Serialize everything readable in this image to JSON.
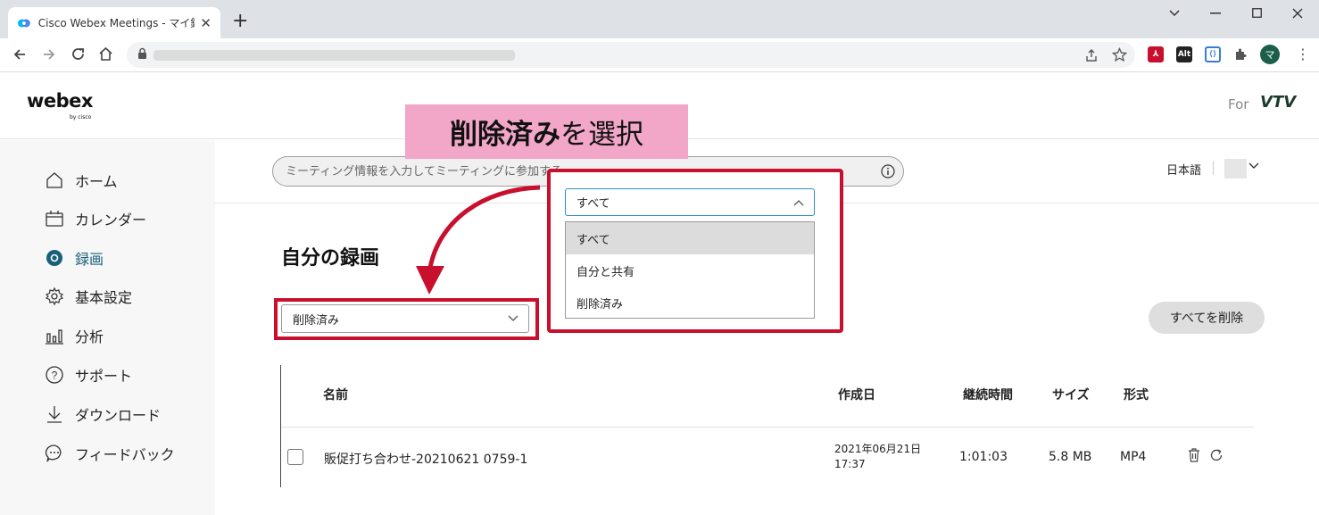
{
  "browser": {
    "tab_title": "Cisco Webex Meetings - マイ録画",
    "avatar_letter": "マ",
    "ext_alt_label": "Alt"
  },
  "header": {
    "logo_main": "webex",
    "logo_sub": "by cisco",
    "for_label": "For",
    "org_logo": "VTV"
  },
  "sidebar": {
    "items": [
      {
        "label": "ホーム",
        "icon": "home-icon"
      },
      {
        "label": "カレンダー",
        "icon": "calendar-icon"
      },
      {
        "label": "録画",
        "icon": "recording-icon"
      },
      {
        "label": "基本設定",
        "icon": "gear-icon"
      },
      {
        "label": "分析",
        "icon": "analytics-icon"
      },
      {
        "label": "サポート",
        "icon": "help-icon"
      },
      {
        "label": "ダウンロード",
        "icon": "download-icon"
      },
      {
        "label": "フィードバック",
        "icon": "feedback-icon"
      }
    ],
    "active_index": 2
  },
  "search": {
    "placeholder": "ミーティング情報を入力してミーティングに参加する"
  },
  "language": "日本語",
  "main": {
    "title": "自分の録画",
    "filter_value": "削除済み",
    "delete_all_label": "すべてを削除",
    "columns": [
      "名前",
      "作成日",
      "継続時間",
      "サイズ",
      "形式"
    ],
    "rows": [
      {
        "name": "販促打ち合わせ-20210621 0759-1",
        "date_line1": "2021年06月21日",
        "date_line2": "17:37",
        "duration": "1:01:03",
        "size": "5.8 MB",
        "format": "MP4"
      }
    ]
  },
  "dropdown": {
    "selected": "すべて",
    "options": [
      "すべて",
      "自分と共有",
      "削除済み"
    ]
  },
  "annotation": {
    "bold_text": "削除済み",
    "rest_text": "を選択",
    "color": "#c8102e",
    "bg": "#f2a6c8"
  }
}
